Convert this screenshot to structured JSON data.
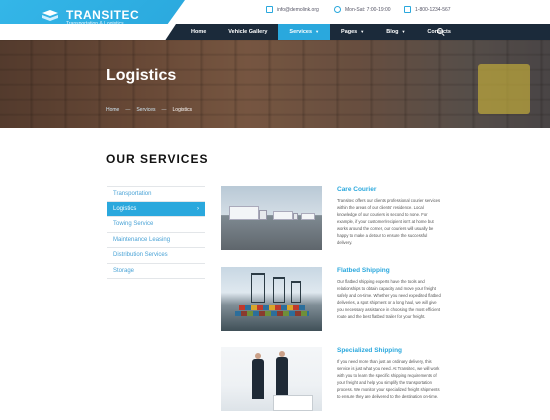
{
  "brand": {
    "name": "TRANSITEC",
    "tagline": "Transportation & Logistics",
    "accent": "#2aa8dd",
    "nav_bg": "#1b2a3a"
  },
  "contacts": {
    "email": "info@demolink.org",
    "hours": "Mon-Sat: 7:00-19:00",
    "phone": "1-800-1234-567"
  },
  "nav": {
    "items": [
      {
        "label": "Home",
        "active": false,
        "dropdown": false
      },
      {
        "label": "Vehicle Gallery",
        "active": false,
        "dropdown": false
      },
      {
        "label": "Services",
        "active": true,
        "dropdown": true
      },
      {
        "label": "Pages",
        "active": false,
        "dropdown": true
      },
      {
        "label": "Blog",
        "active": false,
        "dropdown": true
      },
      {
        "label": "Contacts",
        "active": false,
        "dropdown": false
      }
    ],
    "search_icon": "search-icon"
  },
  "hero": {
    "title": "Logistics",
    "breadcrumbs": [
      "Home",
      "Services",
      "Logistics"
    ]
  },
  "section": {
    "title": "OUR SERVICES"
  },
  "side_menu": [
    {
      "label": "Transportation",
      "active": false
    },
    {
      "label": "Logistics",
      "active": true
    },
    {
      "label": "Towing Service",
      "active": false
    },
    {
      "label": "Maintenance Leasing",
      "active": false
    },
    {
      "label": "Distribution Services",
      "active": false
    },
    {
      "label": "Storage",
      "active": false
    }
  ],
  "services": [
    {
      "title": "Care Courier",
      "desc": "Transitec offers our clients professional courier services within the areas of our clients' residence. Local knowledge of our couriers is second to none. For example, if your customer/recipient isn't at home but works around the corner, our couriers will usually be happy to make a detour to ensure the successful delivery."
    },
    {
      "title": "Flatbed Shipping",
      "desc": "Our flatbed shipping experts have the tools and relationships to obtain capacity and move your freight safely and on-time. Whether you need expedited flatbed deliveries, a spot shipment or a long haul, we will give you necessary assistance in choosing the most efficient route and the best flatbed trailer for your freight."
    },
    {
      "title": "Specialized Shipping",
      "desc": "If you need more than just an ordinary delivery, this service is just what you need. At Transitec, we will work with you to learn the specific shipping requirements of your freight and help you simplify the transportation process. We monitor your specialized freight shipments to ensure they are delivered to the destination on-time."
    }
  ]
}
